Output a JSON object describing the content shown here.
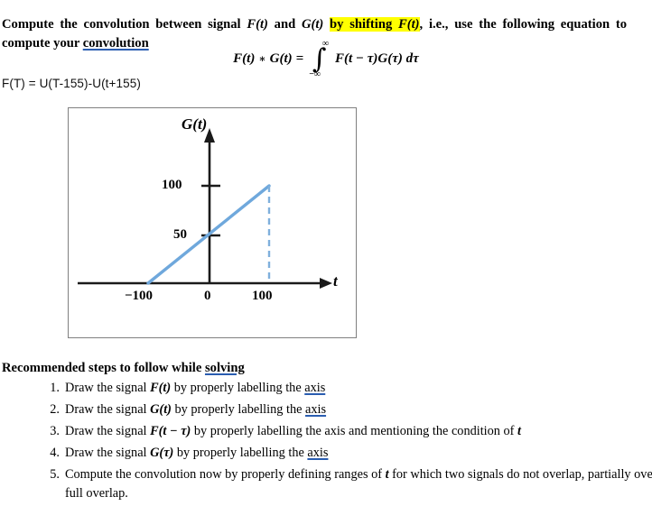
{
  "document": {
    "intro": {
      "line1_a": "Compute the convolution between signal ",
      "var_F": "F(t)",
      "line1_b": " and ",
      "var_G": "G(t)",
      "highlight_a": "by shifting ",
      "highlight_var": "F(t)",
      "line1_c": ", i.e., use the following equation to compute your ",
      "spell_word": "convolution"
    },
    "equation": {
      "lhs_F": "F(t)",
      "star": "∗",
      "lhs_G": "G(t)",
      "equals": "=",
      "integral_symbol": "∫",
      "limit_upper": "∞",
      "limit_lower": "−∞",
      "integrand": "F(t − τ)G(τ) dτ"
    },
    "signal_definition": "F(T) = U(T-155)-U(t+155)",
    "steps_heading_a": "Recommended steps to follow while ",
    "steps_heading_spell": "solving",
    "steps": [
      {
        "number": "1.",
        "pre": "Draw the signal ",
        "math": "F(t)",
        "post": " by properly labelling the ",
        "spell": "axis",
        "tail": ""
      },
      {
        "number": "2.",
        "pre": "Draw the signal ",
        "math": "G(t)",
        "post": " by properly labelling the ",
        "spell": "axis",
        "tail": ""
      },
      {
        "number": "3.",
        "pre": "Draw the signal ",
        "math": "F(t − τ)",
        "post": " by properly labelling the axis and mentioning the condition of ",
        "spell": "",
        "tail": "t"
      },
      {
        "number": "4.",
        "pre": "Draw the signal ",
        "math": "G(τ)",
        "post": " by properly labelling the ",
        "spell": "axis",
        "tail": ""
      },
      {
        "number": "5.",
        "pre": "Compute the convolution now by properly defining ranges of ",
        "math": "t",
        "post": " for which two signals do not overlap, partially overlap or full overlap.",
        "spell": "",
        "tail": ""
      }
    ]
  },
  "chart_data": {
    "type": "line",
    "title": "",
    "xlabel": "t",
    "ylabel": "G(t)",
    "xlim": [
      -165,
      165
    ],
    "ylim": [
      0,
      135
    ],
    "grid": false,
    "legend": "none",
    "x_ticks": [
      -100,
      0,
      100
    ],
    "x_tick_labels": [
      "−100",
      "0",
      "100"
    ],
    "y_ticks": [
      50,
      100
    ],
    "y_tick_labels": [
      "50",
      "100"
    ],
    "series": [
      {
        "name": "G(t)",
        "type": "ramp",
        "color": "#6FA8DC",
        "x": [
          -100,
          0,
          100
        ],
        "values": [
          0,
          50,
          100
        ]
      }
    ],
    "annotations": [
      {
        "name": "drop-line",
        "style": "dashed",
        "color": "#7FB0DC",
        "from": [
          100,
          100
        ],
        "to": [
          100,
          0
        ]
      }
    ],
    "colors": {
      "signal": "#6FA8DC",
      "dashed": "#7FB0DC",
      "axis": "#1a1a1a",
      "box_border": "#808080",
      "highlight": "#ffff00",
      "spellcheck_underline": "#2a5db0"
    }
  }
}
